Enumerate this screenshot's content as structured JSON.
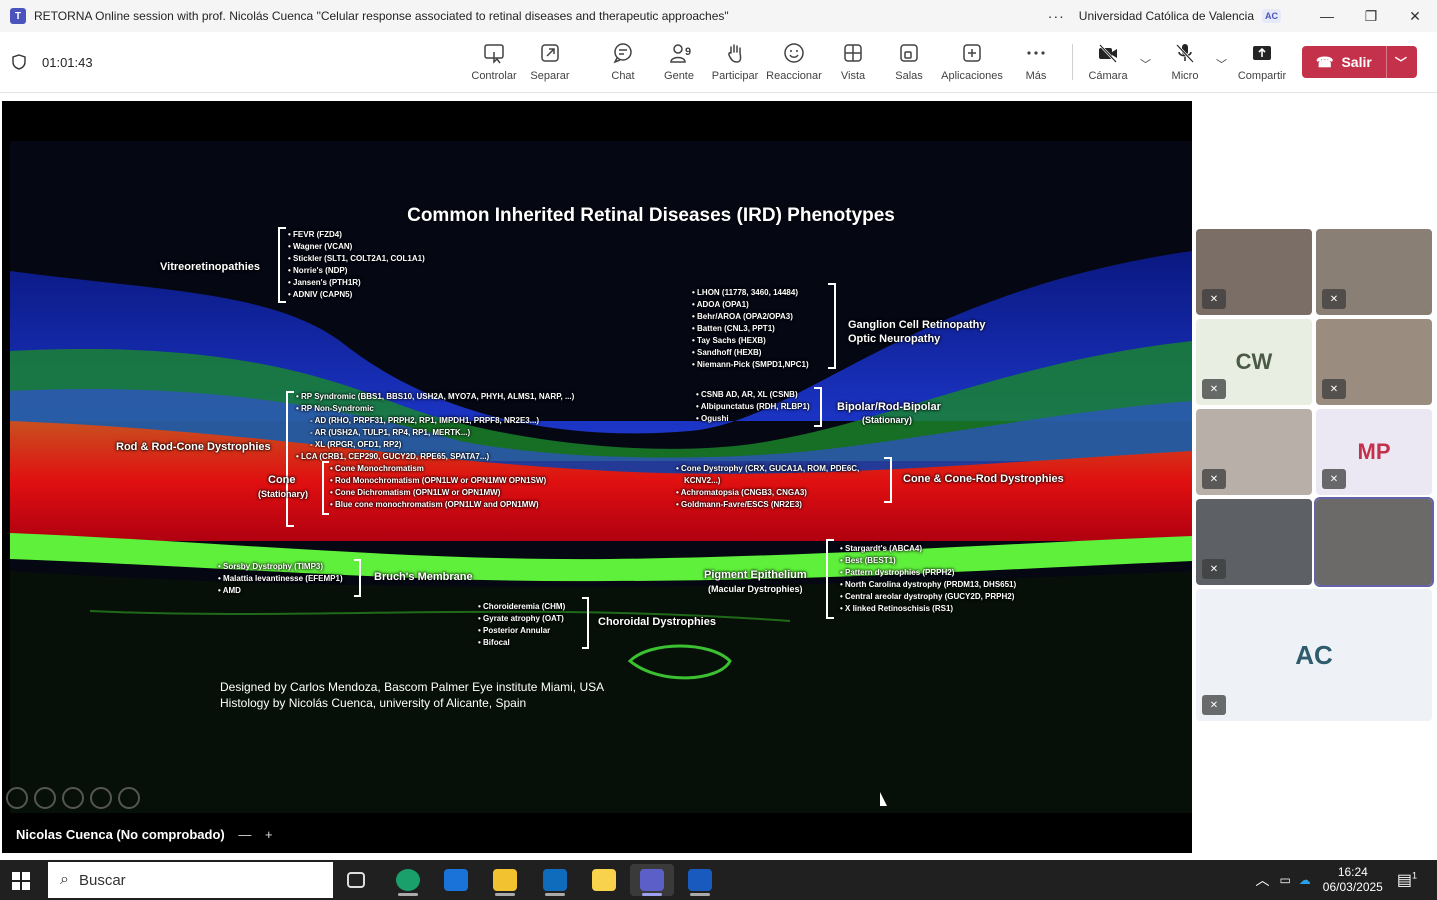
{
  "window": {
    "app_icon": "teams-icon",
    "title": "RETORNA Online session with prof. Nicolás Cuenca \"Celular response associated to retinal diseases and therapeutic approaches\"",
    "org": "Universidad Católica de Valencia",
    "org_badge": "AC"
  },
  "toolbar": {
    "timer": "01:01:43",
    "buttons": [
      {
        "label": "Controlar",
        "icon": "control-icon"
      },
      {
        "label": "Separar",
        "icon": "popout-icon"
      },
      {
        "label": "Chat",
        "icon": "chat-icon"
      },
      {
        "label": "Gente",
        "icon": "people-icon",
        "count": "9"
      },
      {
        "label": "Participar",
        "icon": "raise-hand-icon"
      },
      {
        "label": "Reaccionar",
        "icon": "smile-icon"
      },
      {
        "label": "Vista",
        "icon": "grid-icon"
      },
      {
        "label": "Salas",
        "icon": "rooms-icon"
      },
      {
        "label": "Aplicaciones",
        "icon": "add-app-icon"
      },
      {
        "label": "Más",
        "icon": "more-icon"
      },
      {
        "label": "Cámara",
        "icon": "camera-off-icon"
      },
      {
        "label": "Micro",
        "icon": "mic-off-icon"
      },
      {
        "label": "Compartir",
        "icon": "share-icon"
      }
    ],
    "leave_label": "Salir",
    "accent": "#c4314b"
  },
  "slide": {
    "title": "Common Inherited Retinal Diseases (IRD) Phenotypes",
    "vitreo": {
      "label": "Vitreoretinopathies",
      "items": [
        "• FEVR (FZD4)",
        "• Wagner (VCAN)",
        "• Stickler (SLT1, COLT2A1, COL1A1)",
        "• Norrie's (NDP)",
        "• Jansen's (PTH1R)",
        "• ADNIV (CAPN5)"
      ]
    },
    "ganglion": {
      "label": "Ganglion Cell Retinopathy",
      "label2": "Optic Neuropathy",
      "items": [
        "• LHON (11778, 3460, 14484)",
        "• ADOA (OPA1)",
        "• Behr/AROA (OPA2/OPA3)",
        "• Batten (CNL3, PPT1)",
        "• Tay Sachs (HEXB)",
        "• Sandhoff (HEXB)",
        "• Niemann-Pick (SMPD1,NPC1)"
      ]
    },
    "bipolar": {
      "label": "Bipolar/Rod-Bipolar",
      "sub": "(Stationary)",
      "items": [
        "• CSNB AD, AR, XL (CSNB)",
        "• Albipunctatus (RDH, RLBP1)",
        "• Ogushi"
      ]
    },
    "rod": {
      "label": "Rod & Rod-Cone Dystrophies",
      "items": [
        "• RP Syndromic (BBS1, BBS10, USH2A, MYO7A, PHYH, ALMS1, NARP, ...)",
        "• RP Non-Syndromic",
        "- AD (RHO, PRPF31, PRPH2, RP1, IMPDH1, PRPF8, NR2E3...)",
        "- AR (USH2A, TULP1, RP4, RP1, MERTK...)",
        "- XL (RPGR, OFD1, RP2)",
        "• LCA (CRB1, CEP290, GUCY2D, RPE65, SPATA7...)"
      ]
    },
    "cone": {
      "label": "Cone",
      "sub": "(Stationary)",
      "items": [
        "• Cone Monochromatism",
        "• Rod Monochromatism (OPN1LW or OPN1MW OPN1SW)",
        "• Cone Dichromatism (OPN1LW or OPN1MW)",
        "• Blue cone monochromatism (OPN1LW and OPN1MW)"
      ]
    },
    "conerod": {
      "label": "Cone & Cone-Rod Dystrophies",
      "items": [
        "• Cone Dystrophy (CRX, GUCA1A, ROM, PDE6C,",
        "  KCNV2...)",
        "• Achromatopsia (CNGB3, CNGA3)",
        "• Goldmann-Favre/ESCS (NR2E3)"
      ]
    },
    "bruch": {
      "label": "Bruch's Membrane",
      "items": [
        "• Sorsby Dystrophy (TIMP3)",
        "• Malattia levantinesse (EFEMP1)",
        "• AMD"
      ]
    },
    "pigment": {
      "label": "Pigment Epithelium",
      "sub": "(Macular Dystrophies)",
      "items": [
        "• Stargardt's (ABCA4)",
        "• Best (BEST1)",
        "• Pattern dystrophies (PRPH2)",
        "• North Carolina dystrophy (PRDM13, DHS651)",
        "• Central areolar dystrophy (GUCY2D, PRPH2)",
        "• X linked Retinoschisis (RS1)"
      ]
    },
    "choroidal": {
      "label": "Choroidal Dystrophies",
      "items": [
        "• Choroideremia (CHM)",
        "• Gyrate atrophy (OAT)",
        "• Posterior Annular",
        "• Bifocal"
      ]
    },
    "credits": [
      "Designed by Carlos Mendoza, Bascom Palmer Eye institute Miami, USA",
      "Histology by Nicolás Cuenca, university of Alicante, Spain"
    ]
  },
  "presenter": {
    "name": "Nicolas Cuenca (No comprobado)",
    "minus": "—",
    "plus": "+"
  },
  "participants": [
    {
      "kind": "video",
      "color": "#7b6e67"
    },
    {
      "kind": "video",
      "color": "#8a7f74"
    },
    {
      "kind": "initials",
      "initials": "CW",
      "bg": "#e8eee2",
      "fg": "#4a5a44"
    },
    {
      "kind": "video",
      "color": "#9a8c7f"
    },
    {
      "kind": "video",
      "color": "#b8b0a8"
    },
    {
      "kind": "initials",
      "initials": "MP",
      "bg": "#ece8f3",
      "fg": "#c4314b"
    },
    {
      "kind": "video",
      "color": "#5d6166"
    },
    {
      "kind": "video",
      "color": "#6c6a68",
      "active": true
    }
  ],
  "self": {
    "initials": "AC",
    "bg": "#eef2f7",
    "fg": "#2f5b6e"
  },
  "taskbar": {
    "search_placeholder": "Buscar",
    "time": "16:24",
    "date": "06/03/2025",
    "notif_count": "1",
    "apps": [
      "task-view-icon",
      "edge-icon",
      "store-icon",
      "explorer-icon",
      "outlook-icon",
      "sticky-notes-icon",
      "teams-icon",
      "word-icon"
    ]
  }
}
